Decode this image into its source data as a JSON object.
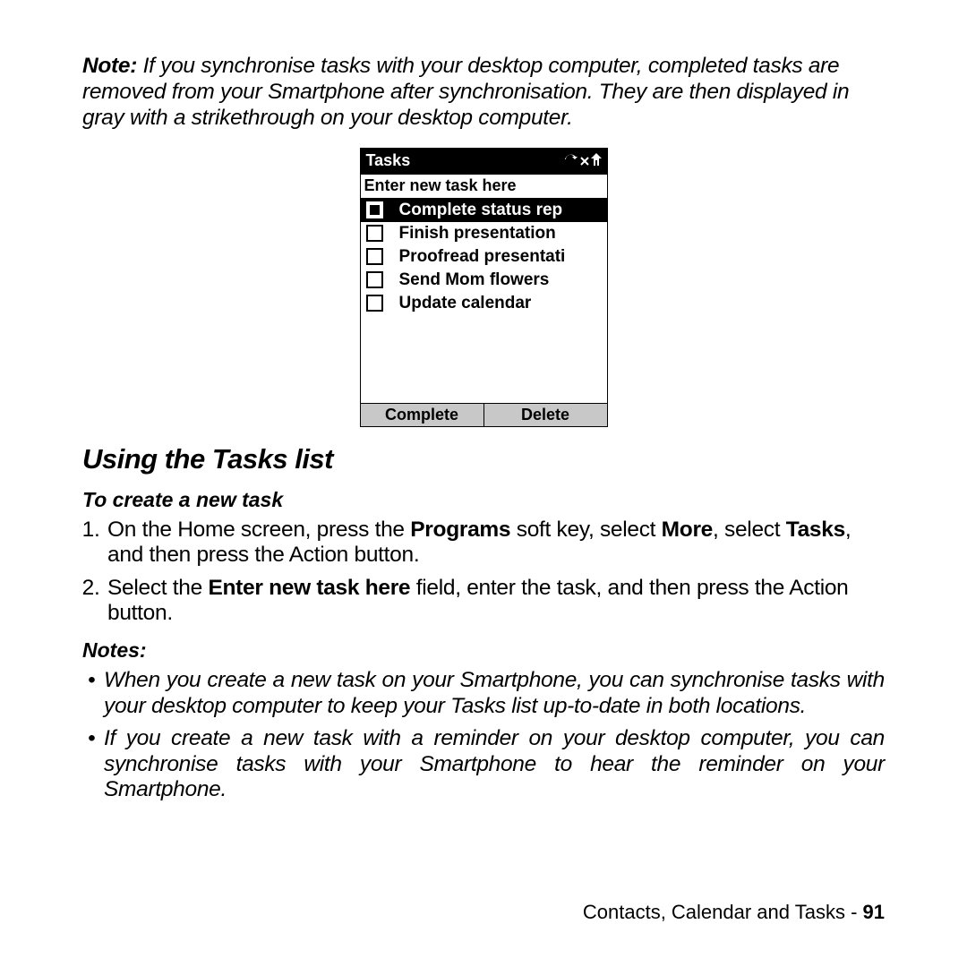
{
  "note": {
    "label": "Note:",
    "text": " If you synchronise tasks with your desktop computer, completed tasks are removed from your Smartphone after synchronisation. They are then displayed in gray with a strikethrough on your desktop computer."
  },
  "device": {
    "title": "Tasks",
    "input_placeholder": "Enter new task here",
    "tasks": [
      {
        "label": "Complete status rep",
        "selected": true
      },
      {
        "label": "Finish presentation",
        "selected": false
      },
      {
        "label": "Proofread presentati",
        "selected": false
      },
      {
        "label": "Send Mom flowers",
        "selected": false
      },
      {
        "label": "Update calendar",
        "selected": false
      }
    ],
    "softkeys": {
      "left": "Complete",
      "right": "Delete"
    }
  },
  "section_heading": "Using the Tasks list",
  "subheading": "To create a new task",
  "steps": {
    "s1a": "On the Home screen, press the ",
    "s1b": "Programs",
    "s1c": " soft key, select ",
    "s1d": "More",
    "s1e": ", select ",
    "s1f": "Tasks",
    "s1g": ", and then press the Action button.",
    "s2a": "Select the ",
    "s2b": "Enter new task here",
    "s2c": " field, enter the task, and then press the Action button."
  },
  "notes_heading": "Notes:",
  "notes": [
    "When you create a new task on your Smartphone, you can synchronise tasks with your desktop computer to keep your Tasks list up-to-date in both locations.",
    "If you create a new task with a reminder on your desktop computer, you can synchronise tasks with your Smartphone to hear the reminder on your Smartphone."
  ],
  "footer": {
    "text": "Contacts, Calendar and Tasks - ",
    "page": "91"
  }
}
